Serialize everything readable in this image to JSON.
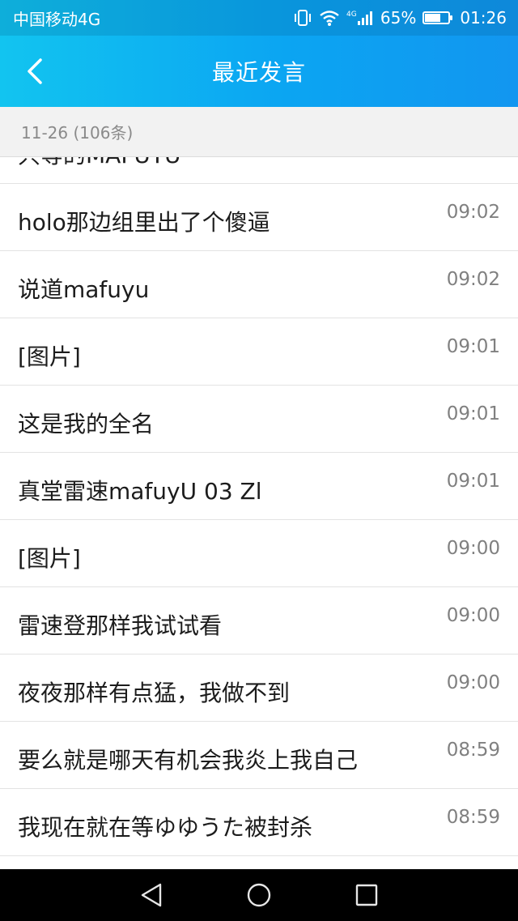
{
  "status_bar": {
    "carrier": "中国移动4G",
    "network_label": "4G",
    "battery_text": "65%",
    "battery_level": 0.65,
    "time": "01:26",
    "icons": [
      "vibrate-icon",
      "wifi-icon",
      "signal-icon",
      "battery-icon"
    ]
  },
  "nav": {
    "title": "最近发言",
    "back_icon": "chevron-left-icon"
  },
  "date_header": "11-26 (106条)",
  "messages": [
    {
      "text": "只等的MAFUYU",
      "time": ""
    },
    {
      "text": "holo那边组里出了个傻逼",
      "time": "09:02"
    },
    {
      "text": "说道mafuyu",
      "time": "09:02"
    },
    {
      "text": "[图片]",
      "time": "09:01"
    },
    {
      "text": "这是我的全名",
      "time": "09:01"
    },
    {
      "text": "真堂雷速mafuyU 03 Zl",
      "time": "09:01"
    },
    {
      "text": "[图片]",
      "time": "09:00"
    },
    {
      "text": "雷速登那样我试试看",
      "time": "09:00"
    },
    {
      "text": "夜夜那样有点猛，我做不到",
      "time": "09:00"
    },
    {
      "text": "要么就是哪天有机会我炎上我自己",
      "time": "08:59"
    },
    {
      "text": "我现在就在等ゆゆうた被封杀",
      "time": "08:59"
    }
  ],
  "system_nav": {
    "back": "back-triangle-icon",
    "home": "home-circle-icon",
    "recents": "recents-square-icon"
  },
  "colors": {
    "header_start": "#12c4f0",
    "header_end": "#1296f0",
    "date_bar_bg": "#f2f2f2"
  }
}
